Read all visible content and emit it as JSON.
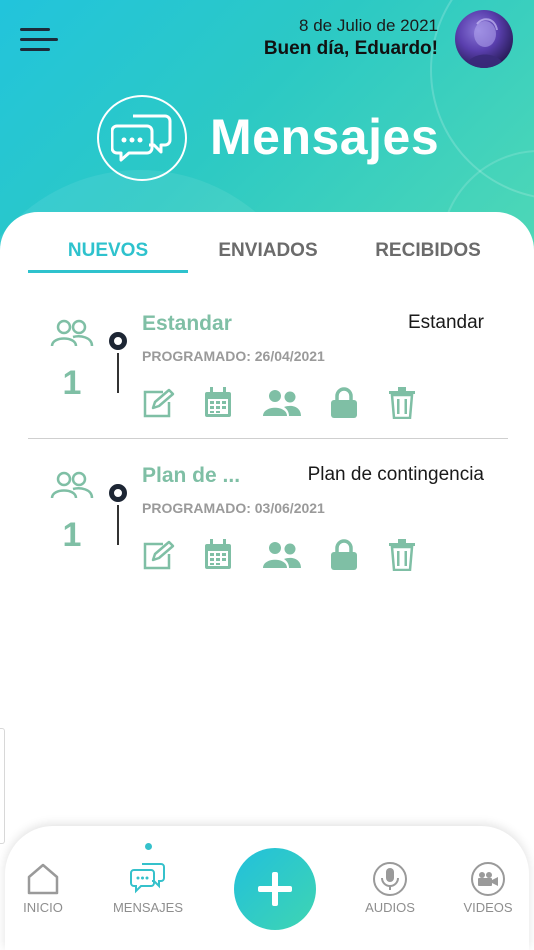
{
  "header": {
    "date": "8 de Julio de 2021",
    "greeting": "Buen día, Eduardo!",
    "title": "Mensajes",
    "icons": {
      "menu": "menu-icon",
      "title": "chat-bubbles-icon",
      "avatar": "user-avatar"
    }
  },
  "tabs": [
    {
      "label": "NUEVOS",
      "active": true
    },
    {
      "label": "ENVIADOS",
      "active": false
    },
    {
      "label": "RECIBIDOS",
      "active": false
    }
  ],
  "messages": [
    {
      "count": "1",
      "name": "Estandar",
      "name_right": "Estandar",
      "scheduled": "PROGRAMADO: 26/04/2021",
      "actions": [
        "edit-icon",
        "calendar-icon",
        "users-icon",
        "lock-icon",
        "trash-icon"
      ]
    },
    {
      "count": "1",
      "name": "Plan de ...",
      "name_right": "Plan de contingencia",
      "scheduled": "PROGRAMADO: 03/06/2021",
      "actions": [
        "edit-icon",
        "calendar-icon",
        "users-icon",
        "lock-icon",
        "trash-icon"
      ]
    }
  ],
  "nav": {
    "items": [
      {
        "label": "INICIO",
        "icon": "home-icon"
      },
      {
        "label": "MENSAJES",
        "icon": "chat-bubbles-icon",
        "active": true
      },
      {
        "label": "AUDIOS",
        "icon": "microphone-icon"
      },
      {
        "label": "VIDEOS",
        "icon": "video-camera-icon"
      }
    ],
    "fab_icon": "plus-icon"
  },
  "colors": {
    "accent": "#2ec2cd",
    "green": "#7fbfa5",
    "header_start": "#22c4dc",
    "header_end": "#4fd8b6"
  }
}
